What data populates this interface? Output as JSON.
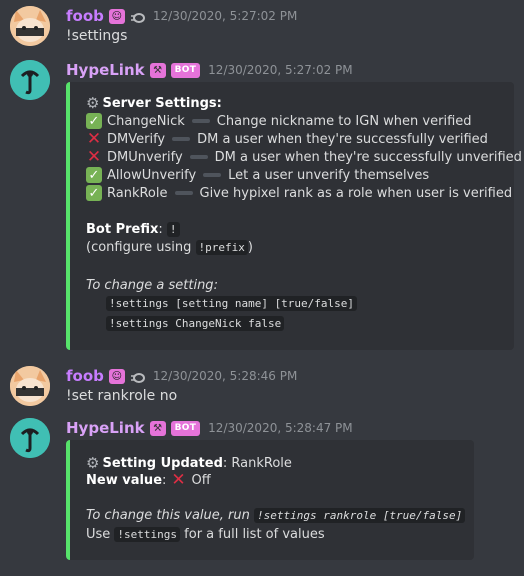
{
  "messages": [
    {
      "author": "foob",
      "timestamp": "12/30/2020, 5:27:02 PM",
      "text": "!settings"
    },
    {
      "author": "HypeLink",
      "badge": "BOT",
      "timestamp": "12/30/2020, 5:27:02 PM"
    },
    {
      "author": "foob",
      "timestamp": "12/30/2020, 5:28:46 PM",
      "text": "!set rankrole no"
    },
    {
      "author": "HypeLink",
      "badge": "BOT",
      "timestamp": "12/30/2020, 5:28:47 PM"
    }
  ],
  "settings_embed": {
    "title": "Server Settings:",
    "settings": [
      {
        "name": "ChangeNick",
        "enabled": true,
        "desc": "Change nickname to IGN when verified"
      },
      {
        "name": "DMVerify",
        "enabled": false,
        "desc": "DM a user when they're successfully verified"
      },
      {
        "name": "DMUnverify",
        "enabled": false,
        "desc": "DM a user when they're successfully unverified"
      },
      {
        "name": "AllowUnverify",
        "enabled": true,
        "desc": "Let a user unverify themselves"
      },
      {
        "name": "RankRole",
        "enabled": true,
        "desc": "Give hypixel rank as a role when user is verified"
      }
    ],
    "prefix_label": "Bot Prefix",
    "prefix_value": "!",
    "configure_pre": "(configure using ",
    "configure_code": "!prefix",
    "configure_post": ")",
    "change_hint": "To change a setting:",
    "usage_1": "!settings [setting name] [true/false]",
    "usage_2": "!settings ChangeNick false"
  },
  "update_embed": {
    "title": "Setting Updated",
    "setting_name": "RankRole",
    "new_value_label": "New value",
    "new_value": "Off",
    "hint_pre": "To change this value, run ",
    "hint_code": "!settings rankrole [true/false]",
    "use_pre": "Use ",
    "use_code": "!settings",
    "use_post": " for a full list of values"
  },
  "icons": {
    "check": "white-check-mark-icon",
    "cross": "cross-mark-icon",
    "gear": "gear-icon"
  },
  "colors": {
    "background": "#36393f",
    "embed_bg": "#2f3136",
    "embed_accent": "#57e36b",
    "role_pink": "#e573d9",
    "foob_name": "#c77dff",
    "hype_name": "#d9a2f7"
  }
}
